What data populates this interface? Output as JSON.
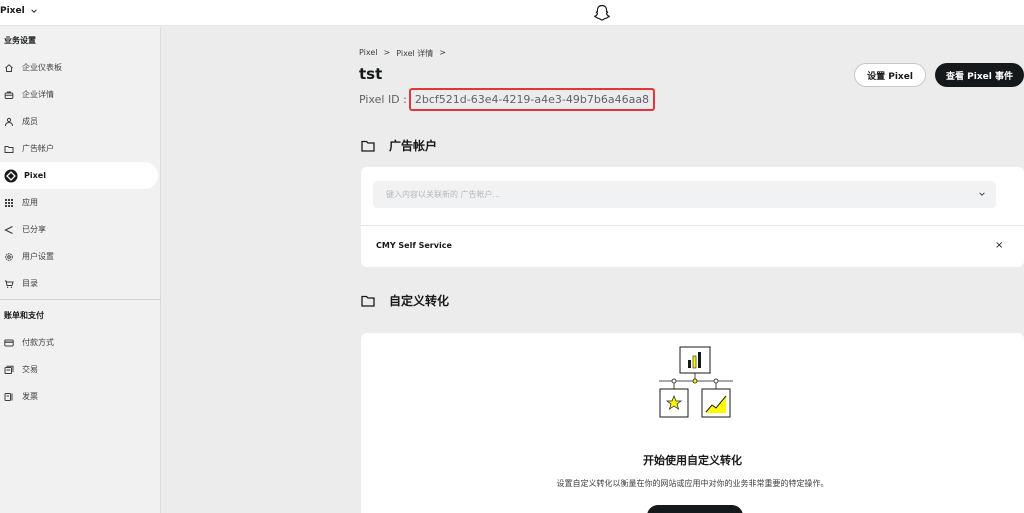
{
  "topbar": {
    "app_name": "Pixel",
    "logo_icon": "snapchat-ghost-icon"
  },
  "sidebar": {
    "sections": [
      {
        "title": "业务设置",
        "items": [
          {
            "label": "企业仪表板",
            "icon": "home-icon"
          },
          {
            "label": "企业详情",
            "icon": "briefcase-icon"
          },
          {
            "label": "成员",
            "icon": "members-icon"
          },
          {
            "label": "广告帐户",
            "icon": "folder-icon"
          },
          {
            "label": "Pixel",
            "icon": "pixel-icon",
            "active": true
          },
          {
            "label": "应用",
            "icon": "apps-grid-icon"
          },
          {
            "label": "已分享",
            "icon": "share-icon"
          },
          {
            "label": "用户设置",
            "icon": "gear-icon"
          },
          {
            "label": "目录",
            "icon": "cart-icon"
          }
        ]
      },
      {
        "title": "账单和支付",
        "items": [
          {
            "label": "付款方式",
            "icon": "credit-card-icon"
          },
          {
            "label": "交易",
            "icon": "transactions-icon"
          },
          {
            "label": "发票",
            "icon": "invoice-icon"
          }
        ]
      }
    ]
  },
  "main": {
    "breadcrumb": [
      "Pixel",
      ">",
      "Pixel 详情",
      ">"
    ],
    "title": "tst",
    "pixel_id_label": "Pixel ID :",
    "pixel_id_value": "2bcf521d-63e4-4219-a4e3-49b7b6a46aa8",
    "setup_button": "设置 Pixel",
    "view_events_button": "查看 Pixel 事件",
    "ad_accounts": {
      "heading": "广告帐户",
      "search_placeholder": "键入内容以关联新的 广告帐户...",
      "linked": [
        "CMY Self Service"
      ],
      "remove_label": "×"
    },
    "custom_conversions": {
      "heading": "自定义转化",
      "empty_title": "开始使用自定义转化",
      "empty_desc": "设置自定义转化以衡量在你的网站或应用中对你的业务非常重要的特定操作。"
    }
  },
  "colors": {
    "highlight_border": "#e0373d",
    "accent_yellow": "#fffc00",
    "dark_button": "#16191c"
  }
}
